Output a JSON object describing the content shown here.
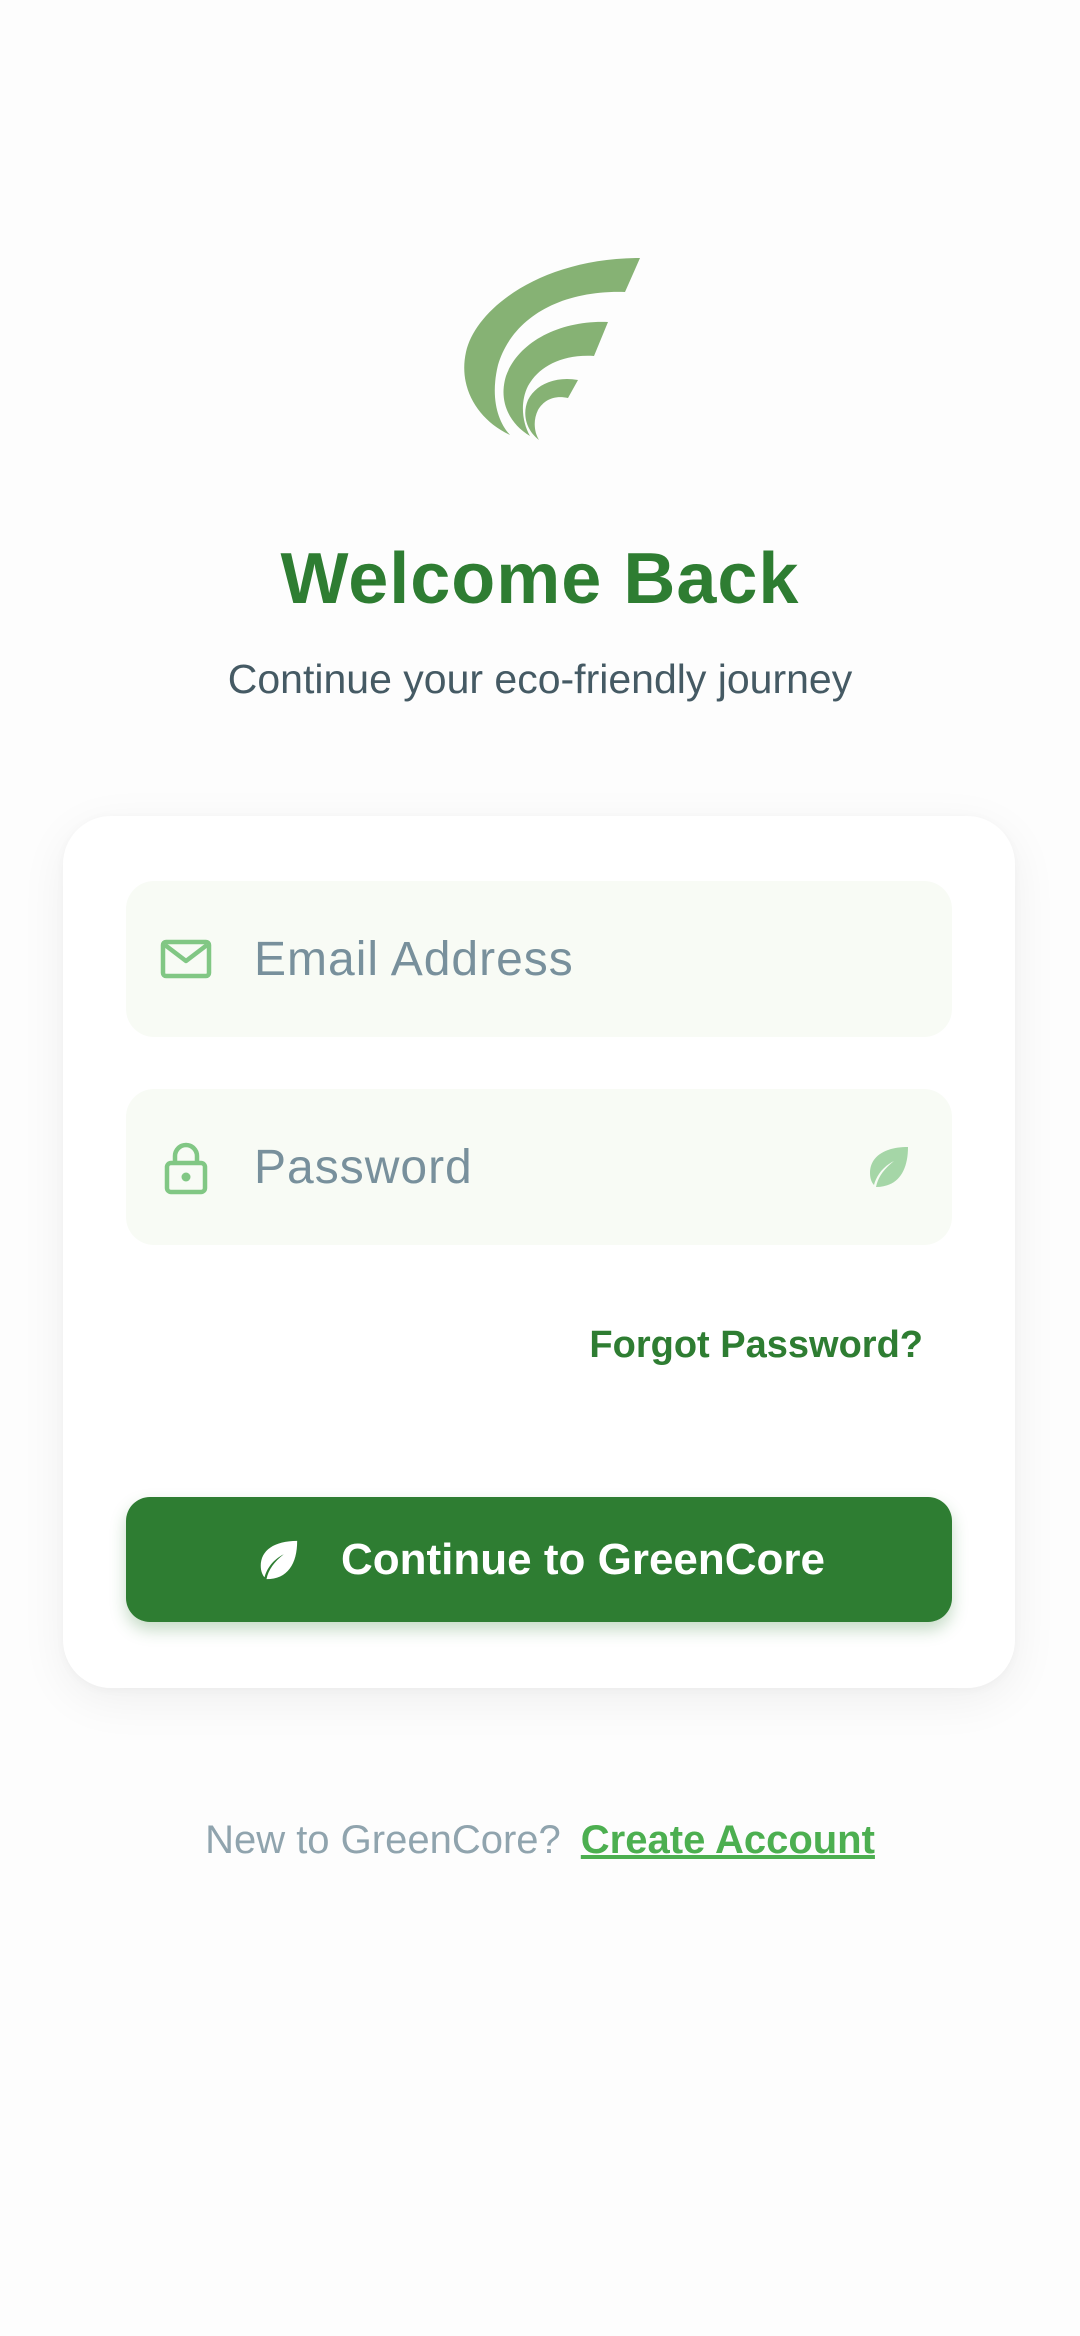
{
  "header": {
    "logo": "greencore-logo",
    "title": "Welcome Back",
    "subtitle": "Continue your eco-friendly journey"
  },
  "form": {
    "email": {
      "icon": "mail-icon",
      "placeholder": "Email Address",
      "value": ""
    },
    "password": {
      "icon": "lock-icon",
      "placeholder": "Password",
      "value": "",
      "toggle_icon": "leaf-icon"
    },
    "forgot_label": "Forgot Password?",
    "submit_label": "Continue to GreenCore",
    "submit_icon": "leaf-icon"
  },
  "footer": {
    "prompt": "New to GreenCore?",
    "link_label": "Create Account"
  },
  "colors": {
    "primary": "#2e7d32",
    "accent": "#4caf50",
    "logo": "#86b274",
    "icon_light": "#81c784",
    "field_bg": "#f8fbf5",
    "subtitle": "#455a64",
    "placeholder": "#78909c"
  }
}
